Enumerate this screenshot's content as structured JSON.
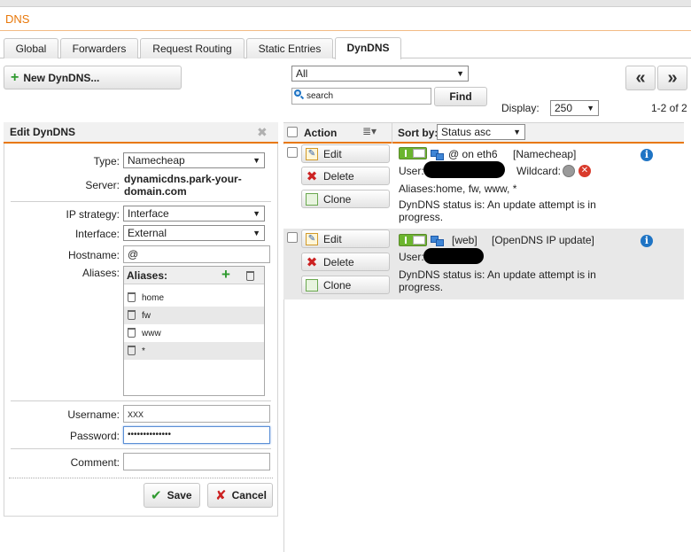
{
  "app": {
    "title": "DNS"
  },
  "tabs": [
    {
      "label": "Global"
    },
    {
      "label": "Forwarders"
    },
    {
      "label": "Request Routing"
    },
    {
      "label": "Static Entries"
    },
    {
      "label": "DynDNS",
      "active": true
    }
  ],
  "toolbar": {
    "new_button": "New DynDNS...",
    "filter_select": "All",
    "search_placeholder": "search",
    "find_button": "Find",
    "display_label": "Display:",
    "display_value": "250",
    "range_text": "1-2 of 2",
    "prev_icon": "«",
    "next_icon": "»"
  },
  "edit_panel": {
    "title": "Edit DynDNS",
    "type_label": "Type:",
    "type_value": "Namecheap",
    "server_label": "Server:",
    "server_value_line1": "dynamicdns.park-your-",
    "server_value_line2": "domain.com",
    "ip_strategy_label": "IP strategy:",
    "ip_strategy_value": "Interface",
    "interface_label": "Interface:",
    "interface_value": "External",
    "hostname_label": "Hostname:",
    "hostname_value": "@",
    "aliases_label": "Aliases:",
    "aliases_header": "Aliases:",
    "aliases": [
      "home",
      "fw",
      "www",
      "*"
    ],
    "username_label": "Username:",
    "username_value": "xxx",
    "password_label": "Password:",
    "password_value": "••••••••••••••",
    "comment_label": "Comment:",
    "comment_value": "",
    "save_button": "Save",
    "cancel_button": "Cancel"
  },
  "grid": {
    "action_header": "Action",
    "sortby_label": "Sort by:",
    "sortby_value": "Status asc",
    "rows": [
      {
        "edit": "Edit",
        "delete": "Delete",
        "clone": "Clone",
        "host": "@ on eth6",
        "provider": "[Namecheap]",
        "user_label": "User:",
        "wildcard_label": "Wildcard:",
        "aliases_text": "Aliases:home, fw, www, *",
        "status_line1": "DynDNS status is: An update attempt is in",
        "status_line2": "progress."
      },
      {
        "edit": "Edit",
        "delete": "Delete",
        "clone": "Clone",
        "host": "[web]",
        "provider": "[OpenDNS IP update]",
        "user_label": "User:",
        "status_line1": "DynDNS status is: An update attempt is in",
        "status_line2": "progress."
      }
    ]
  },
  "colors": {
    "accent": "#e8780a",
    "enabled_toggle": "#6bb52e",
    "info": "#1f74c4",
    "delete_red": "#cc2222"
  }
}
